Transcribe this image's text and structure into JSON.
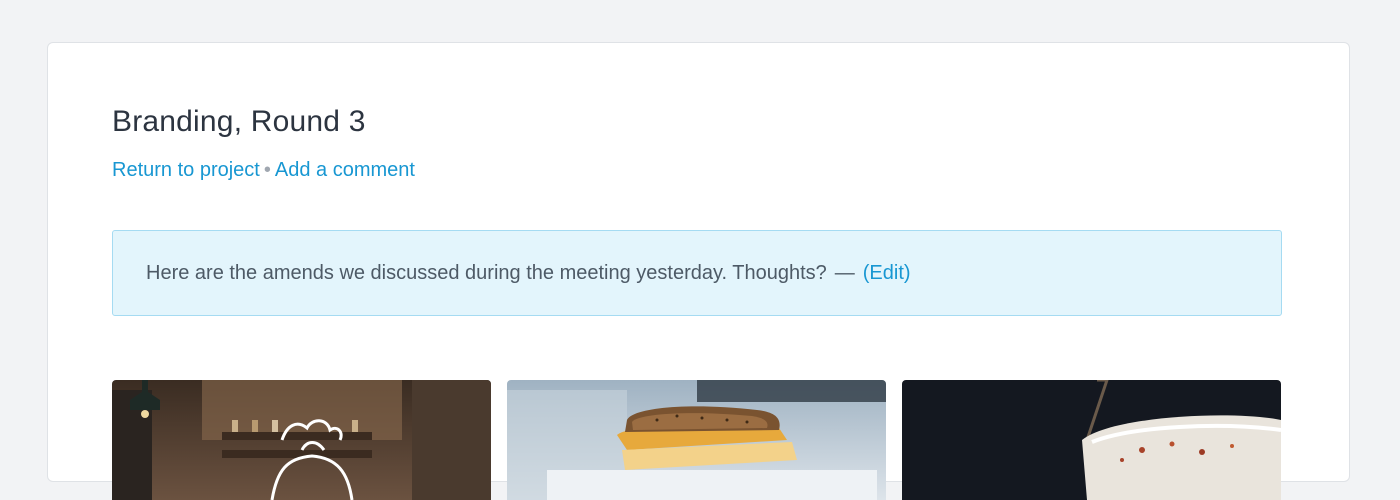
{
  "page": {
    "title": "Branding, Round 3",
    "links": {
      "return": "Return to project",
      "separator": "•",
      "comment": "Add a comment"
    },
    "note": {
      "text": "Here are the amends we discussed during the meeting yesterday. Thoughts?",
      "dash": "—",
      "edit": "(Edit)"
    },
    "thumbnails": [
      {
        "name": "restaurant-interior-image"
      },
      {
        "name": "sandwich-image"
      },
      {
        "name": "dark-bowl-image"
      }
    ]
  },
  "colors": {
    "background": "#f2f3f5",
    "card": "#ffffff",
    "title": "#2c3440",
    "link": "#1897d2",
    "note_bg": "#e3f5fc",
    "note_border": "#a5dbf2",
    "note_text": "#4d5a66"
  }
}
